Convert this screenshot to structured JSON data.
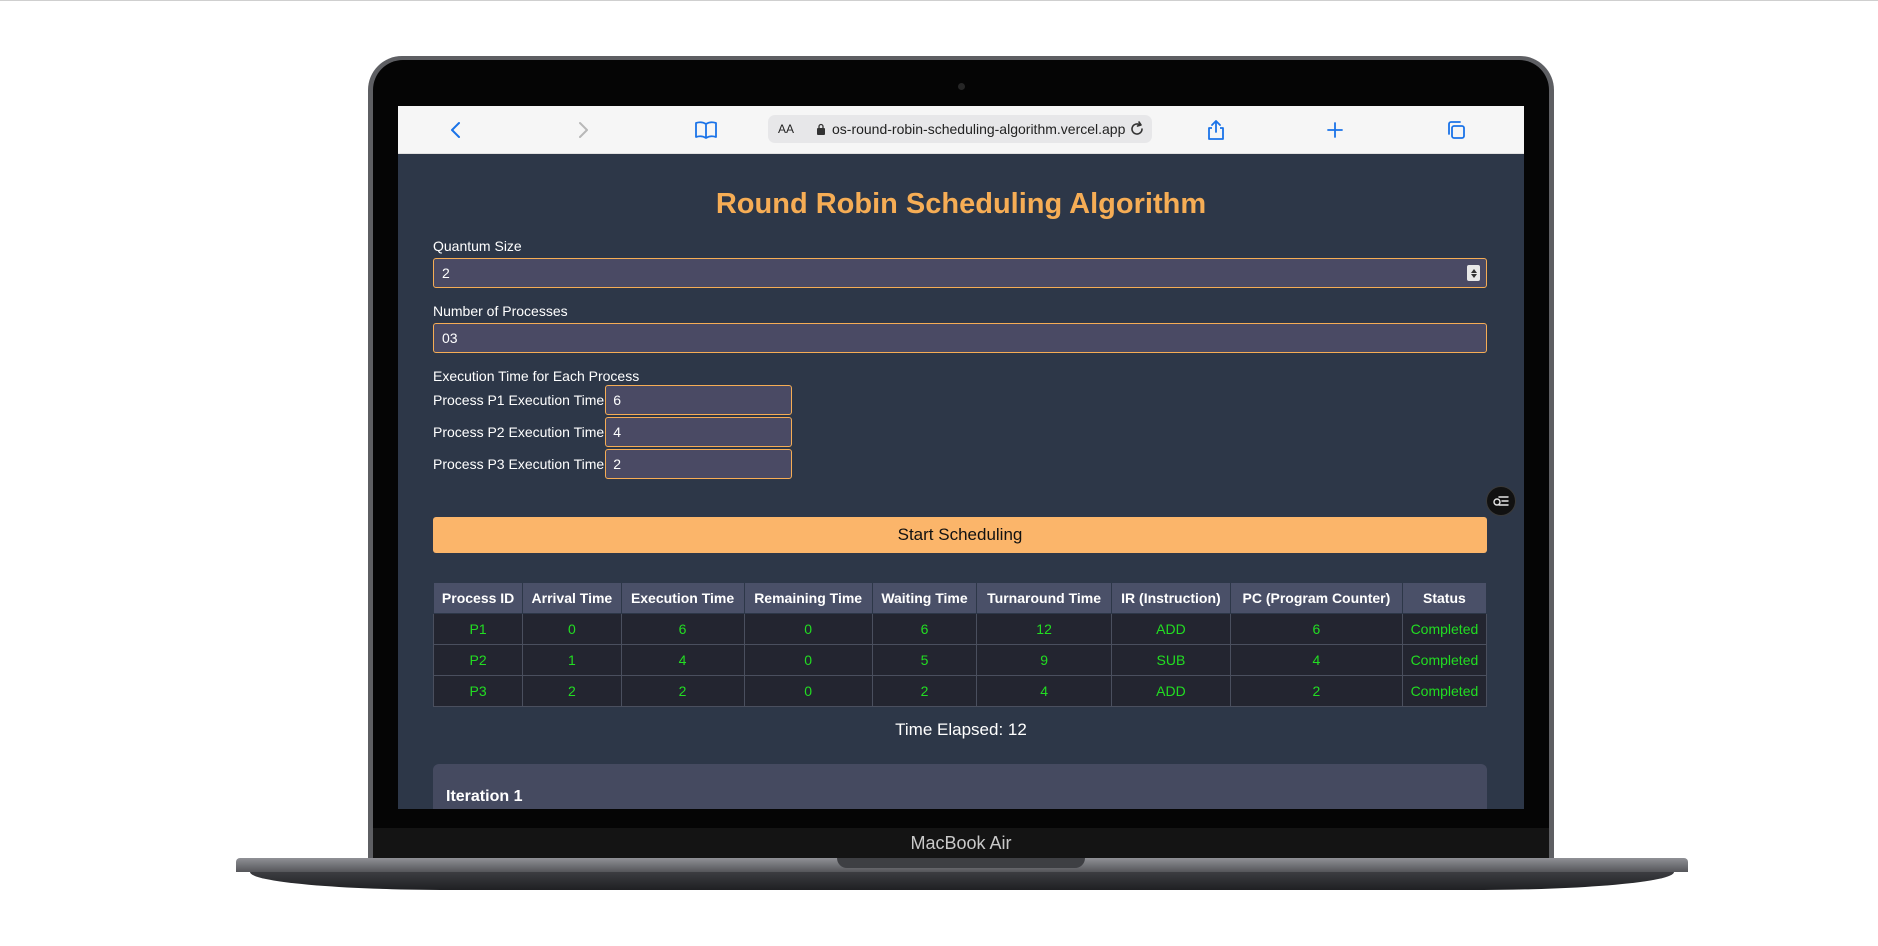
{
  "device": {
    "label": "MacBook Air"
  },
  "browser": {
    "text_size_label": "AA",
    "url": "os-round-robin-scheduling-algorithm.vercel.app"
  },
  "app": {
    "title": "Round Robin Scheduling Algorithm",
    "quantum": {
      "label": "Quantum Size",
      "value": "2"
    },
    "num_processes": {
      "label": "Number of Processes",
      "value": "03"
    },
    "exec_section_label": "Execution Time for Each Process",
    "process_inputs": [
      {
        "label": "Process P1 Execution Time",
        "value": "6"
      },
      {
        "label": "Process P2 Execution Time",
        "value": "4"
      },
      {
        "label": "Process P3 Execution Time",
        "value": "2"
      }
    ],
    "start_button": "Start Scheduling",
    "table": {
      "headers": [
        "Process ID",
        "Arrival Time",
        "Execution Time",
        "Remaining Time",
        "Waiting Time",
        "Turnaround Time",
        "IR (Instruction)",
        "PC (Program Counter)",
        "Status"
      ],
      "rows": [
        [
          "P1",
          "0",
          "6",
          "0",
          "6",
          "12",
          "ADD",
          "6",
          "Completed"
        ],
        [
          "P2",
          "1",
          "4",
          "0",
          "5",
          "9",
          "SUB",
          "4",
          "Completed"
        ],
        [
          "P3",
          "2",
          "2",
          "0",
          "2",
          "4",
          "ADD",
          "2",
          "Completed"
        ]
      ]
    },
    "time_elapsed": "Time Elapsed: 12",
    "iteration_title": "Iteration 1"
  },
  "colors": {
    "accent": "#f6ad55",
    "background": "#2d3748",
    "status_text": "#22dd22",
    "link_blue": "#1a73e8"
  }
}
